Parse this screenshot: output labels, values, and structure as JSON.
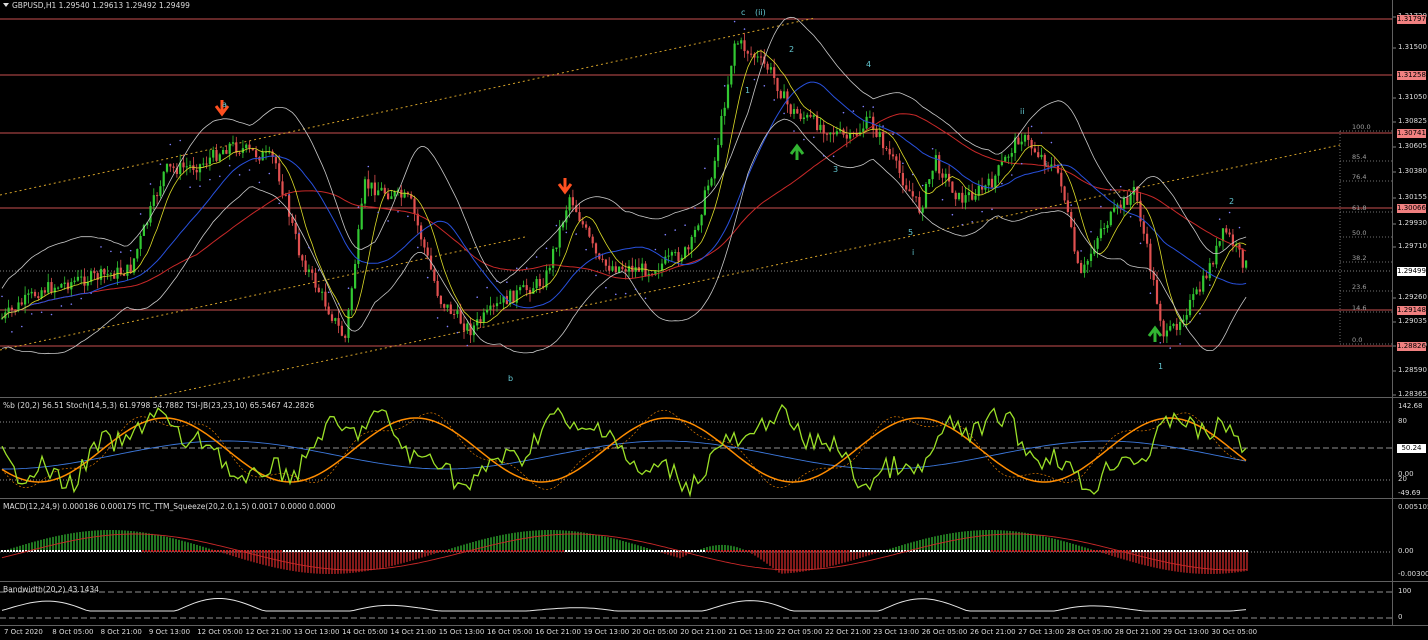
{
  "main": {
    "title": "GBPUSD,H1  1.29540 1.29613 1.29492 1.29499",
    "axis_labels": [
      "1.31720",
      "1.31500",
      "1.31050",
      "1.30825",
      "1.30605",
      "1.30380",
      "1.30155",
      "1.29930",
      "1.29710",
      "1.29260",
      "1.29035",
      "1.28810",
      "1.28590",
      "1.28365"
    ],
    "level_tags": [
      "1.31797",
      "1.31258",
      "1.30741",
      "1.30066",
      "1.29148",
      "1.28826"
    ],
    "current_price": "1.29499",
    "fib_labels": [
      "100.0",
      "85.4",
      "76.4",
      "61.8",
      "50.0",
      "38.2",
      "23.6",
      "14.6",
      "0.0"
    ],
    "wave_labels": [
      "a",
      "c",
      "(ii)",
      "2",
      "1",
      "4",
      "3",
      "5",
      "ii",
      "i",
      "b",
      "2",
      "1",
      "i"
    ]
  },
  "oscillator": {
    "title": "%b (20,2) 56.51  Stoch(14,5,3) 61.9798 54.7882  TSI-JB(23,23,10) 65.5467 42.2826",
    "axis_labels": [
      "142.68",
      "80",
      "50.24",
      "0.00",
      "20",
      "-49.69"
    ]
  },
  "macd": {
    "title": "MACD(12,24,9) 0.000186 0.000175  ITC_TTM_Squeeze(20,2.0,1.5) 0.0017 0.0000 0.0000",
    "axis_labels": [
      "0.005105",
      "0.00",
      "-0.003008"
    ]
  },
  "bandwidth": {
    "title": "Bandwidth(20,2) 43.1434",
    "axis_labels": [
      "100",
      "0"
    ]
  },
  "time_axis": [
    "7 Oct 2020",
    "8 Oct 05:00",
    "8 Oct 21:00",
    "9 Oct 13:00",
    "12 Oct 05:00",
    "12 Oct 21:00",
    "13 Oct 13:00",
    "14 Oct 05:00",
    "14 Oct 21:00",
    "15 Oct 13:00",
    "16 Oct 05:00",
    "16 Oct 21:00",
    "19 Oct 13:00",
    "20 Oct 05:00",
    "20 Oct 21:00",
    "21 Oct 13:00",
    "22 Oct 05:00",
    "22 Oct 21:00",
    "23 Oct 13:00",
    "26 Oct 05:00",
    "26 Oct 21:00",
    "27 Oct 13:00",
    "28 Oct 05:00",
    "28 Oct 21:00",
    "29 Oct 13:00",
    "30 Oct 05:00"
  ],
  "colors": {
    "background": "#000000",
    "bull_candle": "#32c832",
    "bear_candle": "#e05050",
    "level_line": "#c85050",
    "trend_line": "#d2a028",
    "ma_slow": "#c82828",
    "ma_mid": "#2850dc",
    "ma_fast": "#dcdc28",
    "bands": "#c8c8c8",
    "stoch": "#ff8c00",
    "tsi": "#9be028"
  }
}
